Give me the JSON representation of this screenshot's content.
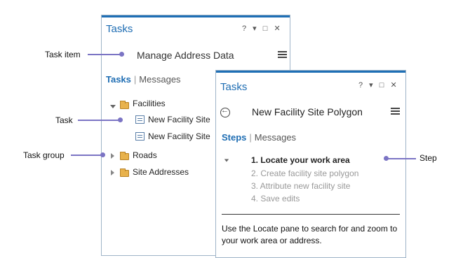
{
  "colors": {
    "accent": "#1e6db3",
    "callout": "#7b74c4",
    "border": "#9fb4c8"
  },
  "callouts": {
    "task_item": "Task item",
    "task": "Task",
    "task_group": "Task group",
    "step": "Step"
  },
  "back_pane": {
    "title": "Tasks",
    "controls": "? ▾ □ ✕",
    "task_item": "Manage Address Data",
    "tabs": {
      "active": "Tasks",
      "separator": "|",
      "inactive": "Messages"
    },
    "tree": [
      {
        "label": "Facilities",
        "expanded": true,
        "icon": "folder-icon"
      },
      {
        "label": "New Facility Site",
        "icon": "task-icon"
      },
      {
        "label": "New Facility Site",
        "icon": "task-icon"
      },
      {
        "label": "Roads",
        "expanded": false,
        "icon": "folder-icon"
      },
      {
        "label": "Site Addresses",
        "expanded": false,
        "icon": "folder-icon"
      }
    ]
  },
  "front_pane": {
    "title": "Tasks",
    "controls": "? ▾ □ ✕",
    "task_name": "New Facility Site Polygon",
    "tabs": {
      "active": "Steps",
      "separator": "|",
      "inactive": "Messages"
    },
    "steps": [
      "1.  Locate your work area",
      "2.  Create facility site  polygon",
      "3.  Attribute new facility site",
      "4.  Save edits"
    ],
    "instructions": "Use the Locate pane to search for and zoom to your work area or address."
  }
}
